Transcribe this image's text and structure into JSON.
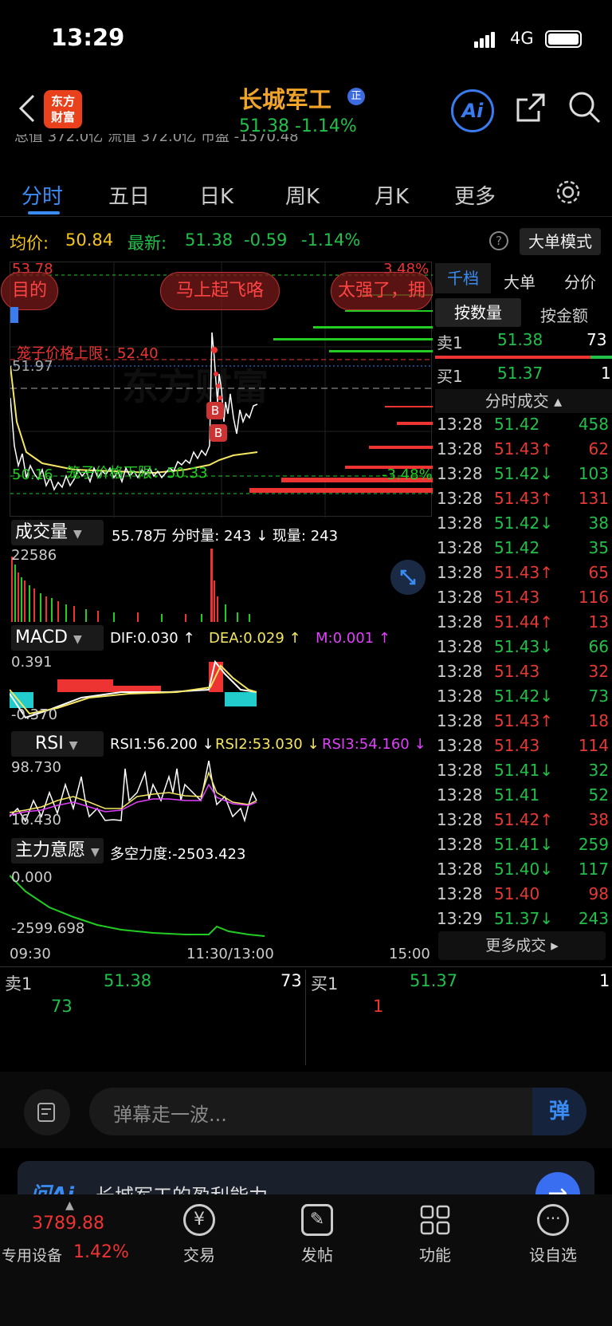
{
  "status": {
    "time": "13:29",
    "network": "4G"
  },
  "header": {
    "logo_text_1": "东方",
    "logo_text_2": "财富",
    "stock_name": "长城军工",
    "badge": "正",
    "price_line": "51.38  -1.14%",
    "ai_label": "Ai"
  },
  "subinfo": {
    "text": "总值 372.0亿  流值 372.0亿  市盈 -1570.48"
  },
  "tabs": [
    "分时",
    "五日",
    "日K",
    "周K",
    "月K",
    "更多"
  ],
  "infobar": {
    "avg_label": "均价:",
    "avg_value": "50.84",
    "last_label": "最新:",
    "last_value": "51.38",
    "change": "-0.59",
    "pct": "-1.14%",
    "mode_button": "大单模式"
  },
  "chart": {
    "y_top": "53.78",
    "y_mid": "51.97",
    "y_bottom": "50.16",
    "pct_top": "3.48%",
    "pct_bottom": "-3.48%",
    "upper_limit": "笼子价格上限：52.40",
    "lower_limit": "笼子价格下限：50.33",
    "danmaku": [
      "目的",
      "马上起飞咯",
      "太强了，拥"
    ],
    "buy_markers": [
      "B",
      "B"
    ],
    "watermark": "东方财富"
  },
  "volume": {
    "label": "成交量",
    "summary": "55.78万 分时量: 243 ↓ 现量: 243",
    "max": "22586"
  },
  "macd": {
    "label": "MACD",
    "dif": "DIF:0.030 ↑",
    "dea": "DEA:0.029 ↑",
    "m": "M:0.001 ↑",
    "top": "0.391",
    "bottom": "-0.370"
  },
  "rsi": {
    "label": "RSI",
    "rsi1": "RSI1:56.200 ↓",
    "rsi2": "RSI2:53.030 ↓",
    "rsi3": "RSI3:54.160 ↓",
    "top": "98.730",
    "bottom": "16.430"
  },
  "zhuli": {
    "label": "主力意愿",
    "value": "多空力度:-2503.423",
    "top": "0.000",
    "bottom": "-2599.698"
  },
  "time_axis": {
    "start": "09:30",
    "mid": "11:30/13:00",
    "end": "15:00"
  },
  "right_panel": {
    "tabs": [
      "千档",
      "大单",
      "分价"
    ],
    "sub_tabs": [
      "按数量",
      "按金额"
    ],
    "ask_label": "卖1",
    "ask_price": "51.38",
    "ask_qty": "73",
    "bid_label": "买1",
    "bid_price": "51.37",
    "bid_qty": "1",
    "trades_title": "分时成交",
    "more": "更多成交 ▸"
  },
  "trades": [
    {
      "t": "13:28",
      "p": "51.42",
      "a": "",
      "q": "458",
      "c": "dn"
    },
    {
      "t": "13:28",
      "p": "51.43",
      "a": "↑",
      "q": "62",
      "c": "up"
    },
    {
      "t": "13:28",
      "p": "51.42",
      "a": "↓",
      "q": "103",
      "c": "dn"
    },
    {
      "t": "13:28",
      "p": "51.43",
      "a": "↑",
      "q": "131",
      "c": "up"
    },
    {
      "t": "13:28",
      "p": "51.42",
      "a": "↓",
      "q": "38",
      "c": "dn"
    },
    {
      "t": "13:28",
      "p": "51.42",
      "a": "",
      "q": "35",
      "c": "dn"
    },
    {
      "t": "13:28",
      "p": "51.43",
      "a": "↑",
      "q": "65",
      "c": "up"
    },
    {
      "t": "13:28",
      "p": "51.43",
      "a": "",
      "q": "116",
      "c": "up"
    },
    {
      "t": "13:28",
      "p": "51.44",
      "a": "↑",
      "q": "13",
      "c": "up"
    },
    {
      "t": "13:28",
      "p": "51.43",
      "a": "↓",
      "q": "66",
      "c": "dn"
    },
    {
      "t": "13:28",
      "p": "51.43",
      "a": "",
      "q": "32",
      "c": "up"
    },
    {
      "t": "13:28",
      "p": "51.42",
      "a": "↓",
      "q": "73",
      "c": "dn"
    },
    {
      "t": "13:28",
      "p": "51.43",
      "a": "↑",
      "q": "18",
      "c": "up"
    },
    {
      "t": "13:28",
      "p": "51.43",
      "a": "",
      "q": "114",
      "c": "up"
    },
    {
      "t": "13:28",
      "p": "51.41",
      "a": "↓",
      "q": "32",
      "c": "dn"
    },
    {
      "t": "13:28",
      "p": "51.41",
      "a": "",
      "q": "52",
      "c": "dn"
    },
    {
      "t": "13:28",
      "p": "51.42",
      "a": "↑",
      "q": "38",
      "c": "up"
    },
    {
      "t": "13:28",
      "p": "51.41",
      "a": "↓",
      "q": "259",
      "c": "dn"
    },
    {
      "t": "13:28",
      "p": "51.40",
      "a": "↓",
      "q": "117",
      "c": "dn"
    },
    {
      "t": "13:28",
      "p": "51.40",
      "a": "",
      "q": "98",
      "c": "up"
    },
    {
      "t": "13:29",
      "p": "51.37",
      "a": "↓",
      "q": "243",
      "c": "dn"
    }
  ],
  "depth": {
    "ask_label": "卖1",
    "ask_price": "51.38",
    "ask_qty": "73",
    "bid_label": "买1",
    "bid_price": "51.37",
    "bid_qty": "1",
    "ask_detail": "73",
    "bid_detail": "1"
  },
  "comment": {
    "placeholder": "弹幕走一波...",
    "send_label": "弹"
  },
  "ai_banner": {
    "logo": "问Ai",
    "text": "长城军工的盈利能力"
  },
  "bottom": {
    "index_value": "3789.88",
    "index_label": "专用设备",
    "index_pct": "1.42%",
    "nav": [
      "交易",
      "发帖",
      "功能",
      "设自选"
    ]
  }
}
